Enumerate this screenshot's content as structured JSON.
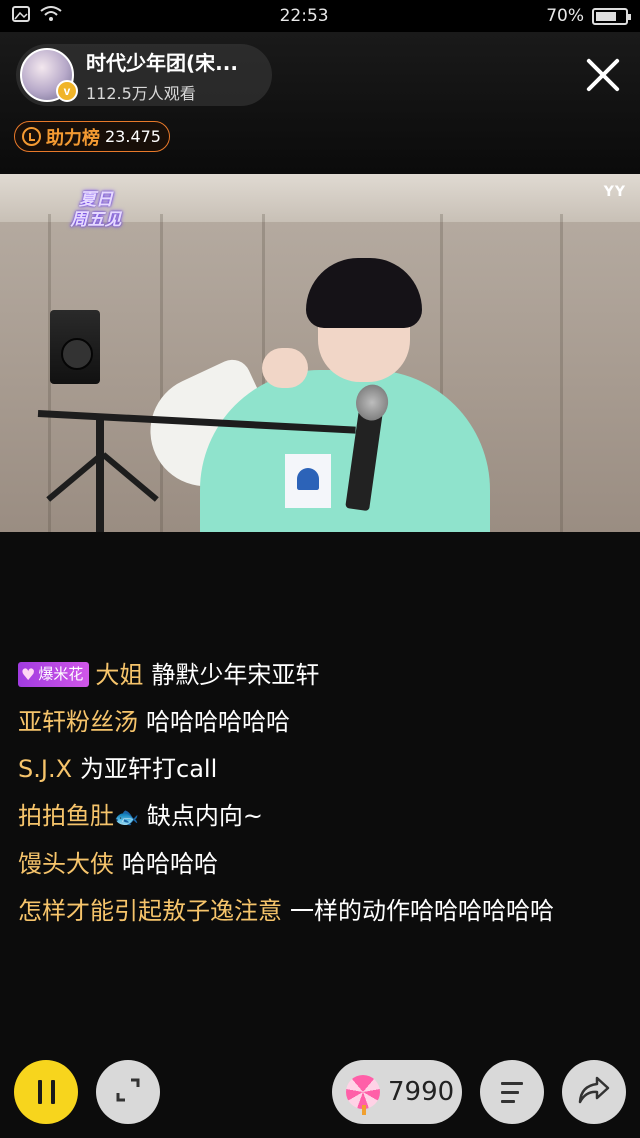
{
  "status_bar": {
    "time": "22:53",
    "battery": "70%",
    "battery_level": 0.7
  },
  "anchor": {
    "name": "时代少年团(宋...",
    "viewers": "112.5万人观看",
    "verified_badge": "v"
  },
  "support_rank": {
    "label": "助力榜",
    "value": "23.475"
  },
  "video": {
    "watermark": "YY",
    "show_logo_line1": "夏日",
    "show_logo_line2": "周五见"
  },
  "comments": [
    {
      "badge": "爆米花",
      "user": "大姐",
      "message": "静默少年宋亚轩"
    },
    {
      "user": "亚轩粉丝汤",
      "message": "哈哈哈哈哈哈"
    },
    {
      "user": "S.J.X",
      "message": "为亚轩打call"
    },
    {
      "user": "拍拍鱼肚",
      "user_emoji": "🐟",
      "message": "缺点内向~"
    },
    {
      "user": "馒头大侠",
      "message": "哈哈哈哈"
    },
    {
      "user": "怎样才能引起敖子逸注意",
      "message": "一样的动作哈哈哈哈哈哈"
    }
  ],
  "controls": {
    "gift_count": "7990"
  },
  "icons": {
    "status": [
      "image-icon",
      "wifi-icon",
      "battery-icon"
    ],
    "header": [
      "avatar",
      "close-icon",
      "support-rank-icon"
    ],
    "controls": [
      "pause-icon",
      "fullscreen-icon",
      "lollipop-gift-icon",
      "menu-icon",
      "share-icon"
    ]
  },
  "colors": {
    "accent_yellow": "#f7d51d",
    "username": "#f6c46b",
    "rank_orange": "#f39a32"
  }
}
